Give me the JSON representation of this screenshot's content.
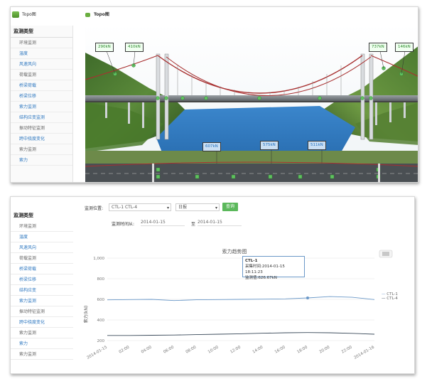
{
  "top": {
    "sidebar_tab": "Topo图",
    "scene_tab": "Topo图",
    "sidebar_header": "监测类型",
    "items": [
      {
        "label": "环境监测",
        "kind": "grp"
      },
      {
        "label": "温度",
        "kind": "sub"
      },
      {
        "label": "风速风向",
        "kind": "sub"
      },
      {
        "label": "荷载监测",
        "kind": "grp"
      },
      {
        "label": "桥梁荷载",
        "kind": "sub"
      },
      {
        "label": "桥梁位移",
        "kind": "sub"
      },
      {
        "label": "索力监测",
        "kind": "sub"
      },
      {
        "label": "结构应变监测",
        "kind": "sub"
      },
      {
        "label": "振动特征监测",
        "kind": "grp"
      },
      {
        "label": "跨中挠度变化",
        "kind": "sub"
      },
      {
        "label": "索力监测",
        "kind": "grp"
      },
      {
        "label": "索力",
        "kind": "sub"
      }
    ],
    "tags": {
      "tl1": "290kN",
      "tl2": "410kN",
      "tr1": "737kN",
      "tr2": "146kN",
      "b1": "607kN",
      "b2": "575kN",
      "b3": "511kN"
    }
  },
  "bottom": {
    "sidebar_header": "监测类型",
    "items": [
      {
        "label": "环境监测",
        "kind": "grp"
      },
      {
        "label": "温度",
        "kind": "sub"
      },
      {
        "label": "风速风向",
        "kind": "sub"
      },
      {
        "label": "荷载监测",
        "kind": "grp"
      },
      {
        "label": "桥梁荷载",
        "kind": "sub"
      },
      {
        "label": "桥梁位移",
        "kind": "sub"
      },
      {
        "label": "结构应变",
        "kind": "sub"
      },
      {
        "label": "索力监测",
        "kind": "sub"
      },
      {
        "label": "振动特征监测",
        "kind": "grp"
      },
      {
        "label": "跨中挠度变化",
        "kind": "sub"
      },
      {
        "label": "索力监测",
        "kind": "grp"
      },
      {
        "label": "索力",
        "kind": "sub"
      },
      {
        "label": "索力监测",
        "kind": "grp"
      }
    ],
    "location_label": "监测位置:",
    "location_value": "CTL-1 CTL-4",
    "period_value": "日报",
    "query_label": "查询",
    "time_label": "监测时间从:",
    "date_from": "2014-01-15",
    "date_to_label": "至",
    "date_to": "2014-01-15",
    "tooltip": {
      "title": "CTL-1",
      "line1": "采集时间:2014-01-15 18:11:23",
      "line2": "监测值:626.67kN"
    },
    "legend": [
      "CTL-1",
      "CTL-4"
    ]
  },
  "chart_data": {
    "type": "line",
    "title": "索力趋势图",
    "ylabel": "索力(kN)",
    "yticks": [
      1000,
      800,
      600,
      400,
      200
    ],
    "ylim": [
      200,
      1000
    ],
    "x": [
      "2014-01-15",
      "02:00",
      "04:00",
      "06:00",
      "08:00",
      "10:00",
      "12:00",
      "14:00",
      "16:00",
      "18:00",
      "20:00",
      "22:00",
      "2014-01-16"
    ],
    "series": [
      {
        "name": "CTL-1",
        "color": "#6a98c8",
        "values": [
          595,
          598,
          600,
          588,
          596,
          598,
          600,
          602,
          605,
          614,
          627,
          620,
          598
        ]
      },
      {
        "name": "CTL-4",
        "color": "#3a4a5a",
        "values": [
          250,
          250,
          252,
          254,
          258,
          262,
          266,
          272,
          276,
          278,
          276,
          270,
          262
        ]
      }
    ]
  },
  "colors": {
    "accent": "#5bb85b",
    "link": "#2f78c0",
    "water": "#3a7fc4"
  }
}
